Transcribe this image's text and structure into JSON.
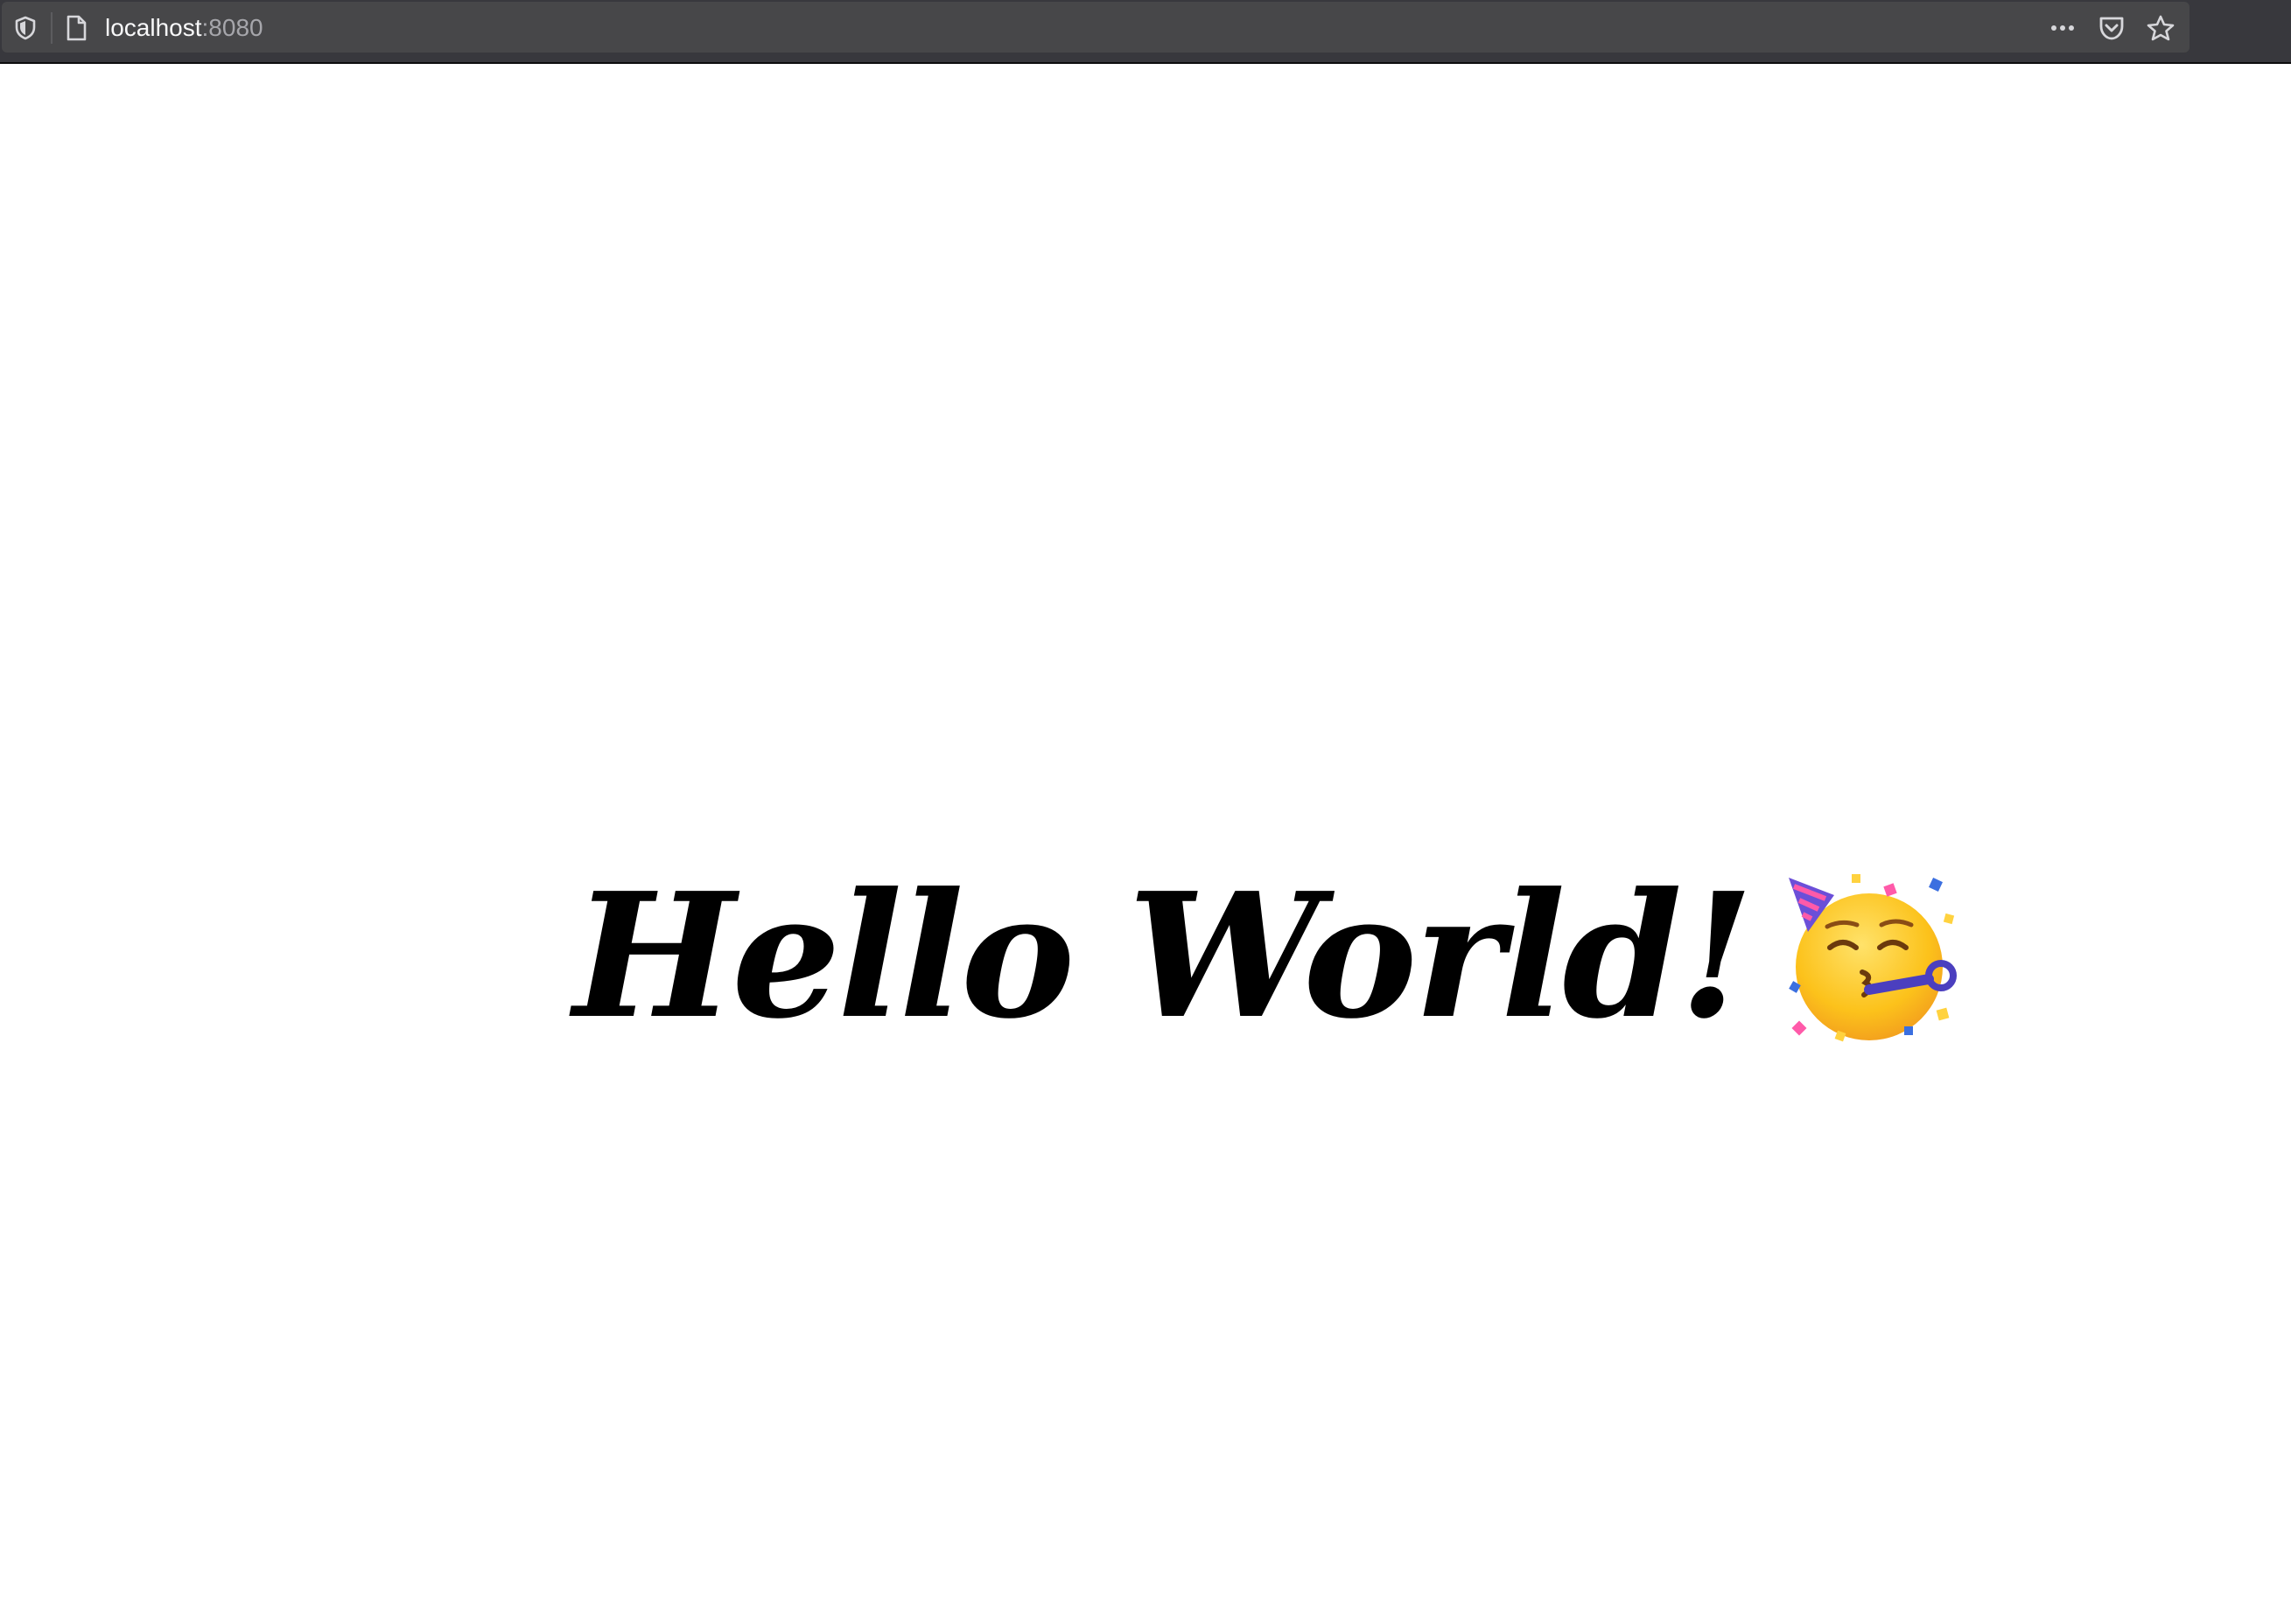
{
  "browser": {
    "url_host": "localhost",
    "url_port": ":8080",
    "icons": {
      "tracking": "shield-icon",
      "page": "page-icon",
      "menu": "more-icon",
      "pocket": "pocket-icon",
      "bookmark": "star-icon"
    }
  },
  "page": {
    "heading": "Hello World!",
    "emoji_name": "party-face-icon"
  },
  "colors": {
    "chrome_bg": "#38383d",
    "url_bar_bg": "#474749",
    "url_host": "#f9f9fa",
    "url_port": "#a6a6ab",
    "page_bg": "#ffffff",
    "heading": "#000000"
  }
}
